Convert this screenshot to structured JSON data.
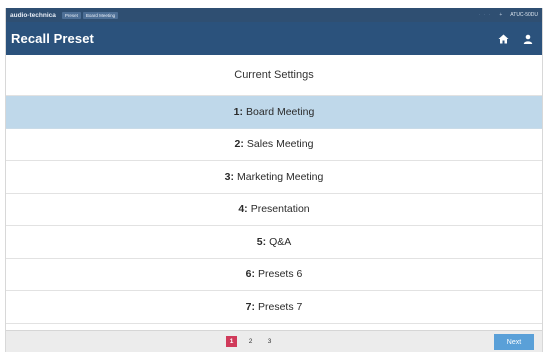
{
  "statusbar": {
    "brand": "audio-technica",
    "crumbs": [
      "Preset",
      "Board Meeting"
    ],
    "dots": "· · ·",
    "indicator": "+",
    "device": "ATUC-50DU"
  },
  "header": {
    "title": "Recall Preset",
    "icons": [
      "home-icon",
      "user-icon"
    ]
  },
  "list": {
    "current_label": "Current Settings",
    "items": [
      {
        "num": "1:",
        "label": "Board Meeting",
        "selected": true
      },
      {
        "num": "2:",
        "label": "Sales Meeting",
        "selected": false
      },
      {
        "num": "3:",
        "label": "Marketing Meeting",
        "selected": false
      },
      {
        "num": "4:",
        "label": "Presentation",
        "selected": false
      },
      {
        "num": "5:",
        "label": "Q&A",
        "selected": false
      },
      {
        "num": "6:",
        "label": "Presets 6",
        "selected": false
      },
      {
        "num": "7:",
        "label": "Presets 7",
        "selected": false
      }
    ]
  },
  "pagination": {
    "pages": [
      "1",
      "2",
      "3"
    ],
    "active": "1"
  },
  "footer": {
    "next_label": "Next"
  },
  "colors": {
    "header_bg": "#2b527c",
    "statusbar_bg": "#2f4f72",
    "selected_row": "#bfd8ea",
    "active_page": "#d03a5a",
    "next_button": "#5aa0d8"
  }
}
